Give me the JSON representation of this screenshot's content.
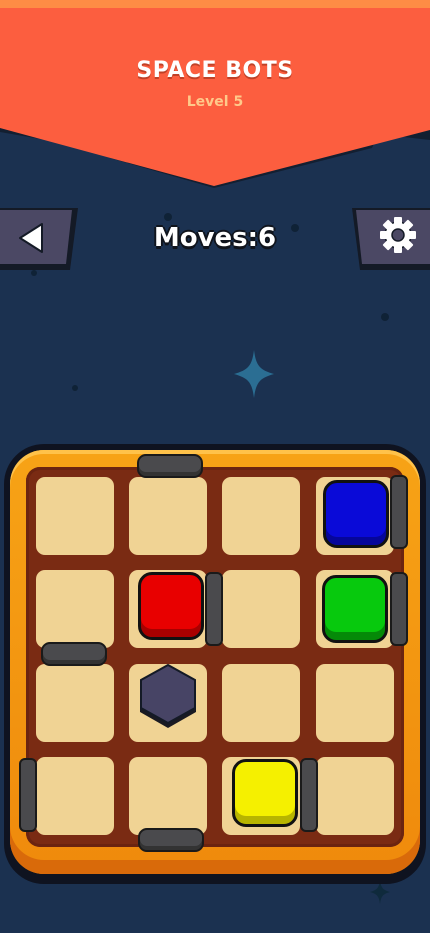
{
  "header": {
    "title": "SPACE BOTS",
    "level": "Level 5",
    "banner_color": "#fc5e3f"
  },
  "toolbar": {
    "back_icon": "back-arrow-icon",
    "settings_icon": "gear-icon"
  },
  "status": {
    "moves_label": "Moves: ",
    "moves_value": "6"
  },
  "board": {
    "rows": 4,
    "cols": 4,
    "frame_color": "#f39b12",
    "tile_color": "#f0d394",
    "bots": [
      {
        "color": "red",
        "hex": "#e80000",
        "row": 2,
        "col": 2
      },
      {
        "color": "blue",
        "hex": "#0a0ad8",
        "row": 1,
        "col": 4
      },
      {
        "color": "green",
        "hex": "#07c90d",
        "row": 2,
        "col": 4
      },
      {
        "color": "yellow",
        "hex": "#f5f000",
        "row": 4,
        "col": 3
      }
    ],
    "obstacle": {
      "type": "hexagon",
      "row": 3,
      "col": 2,
      "hex": "#474465"
    }
  }
}
